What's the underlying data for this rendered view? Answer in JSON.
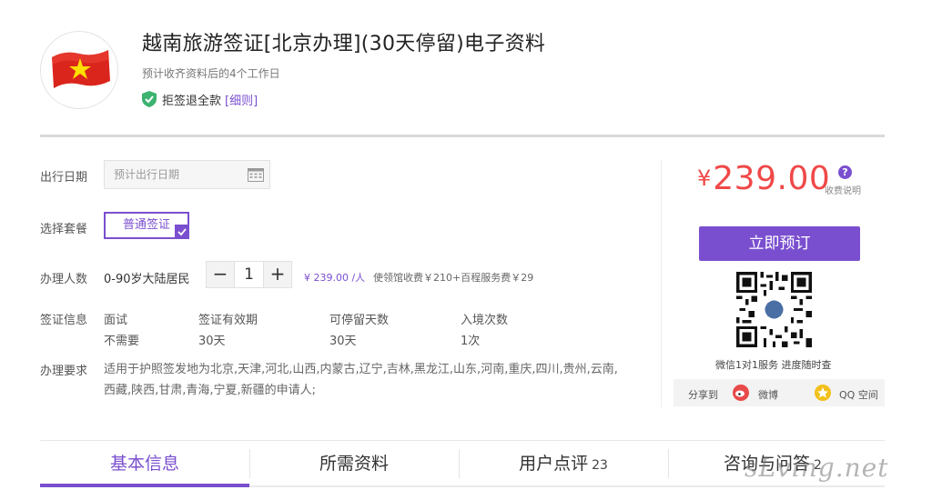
{
  "product": {
    "title": "越南旅游签证[北京办理](30天停留)电子资料",
    "subtitle": "预计收齐资料后的4个工作日",
    "refund_text": "拒签退全款",
    "refund_link": "[细则]"
  },
  "form": {
    "date_label": "出行日期",
    "date_placeholder": "预计出行日期",
    "package_label": "选择套餐",
    "package_selected": "普通签证",
    "applicants_label": "办理人数",
    "applicant_type": "0-90岁大陆居民",
    "quantity_minus": "−",
    "quantity": "1",
    "quantity_plus": "+",
    "unit_price": "¥ 239.00 /人",
    "fee_note": "使领馆收费￥210+百程服务费￥29",
    "visa_info_label": "签证信息",
    "visa_info": {
      "headers": [
        "面试",
        "签证有效期",
        "可停留天数",
        "入境次数"
      ],
      "values": [
        "不需要",
        "30天",
        "30天",
        "1次"
      ]
    },
    "requirement_label": "办理要求",
    "requirement_text": "适用于护照签发地为北京,天津,河北,山西,内蒙古,辽宁,吉林,黑龙江,山东,河南,重庆,四川,贵州,云南,西藏,陕西,甘肃,青海,宁夏,新疆的申请人;"
  },
  "order": {
    "currency": "¥",
    "price": "239.00",
    "help_icon": "?",
    "fee_help": "收费说明",
    "book_button": "立即预订",
    "qr_caption": "微信1对1服务 进度随时查",
    "share_label": "分享到",
    "weibo_label": "微博",
    "qq_label": "QQ 空间"
  },
  "tabs": [
    {
      "label": "基本信息",
      "count": ""
    },
    {
      "label": "所需资料",
      "count": ""
    },
    {
      "label": "用户点评",
      "count": "23"
    },
    {
      "label": "咨询与问答",
      "count": "2"
    }
  ],
  "watermark": "sLving.net",
  "colors": {
    "accent": "#7a4fcf",
    "price": "#f04848",
    "flag_red": "#da251d",
    "flag_star": "#ffde00",
    "shield_green": "#3cb371"
  },
  "icons": [
    "vietnam-flag-icon",
    "shield-check-icon",
    "calendar-icon",
    "checkmark-icon",
    "help-icon",
    "qr-code-icon",
    "weibo-icon",
    "qq-zone-icon"
  ]
}
